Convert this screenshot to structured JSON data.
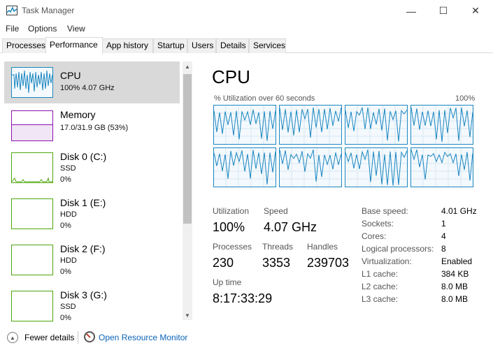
{
  "window": {
    "title": "Task Manager",
    "minimize_glyph": "—",
    "maximize_glyph": "☐",
    "close_glyph": "✕"
  },
  "menu": [
    "File",
    "Options",
    "View"
  ],
  "tabs": [
    "Processes",
    "Performance",
    "App history",
    "Startup",
    "Users",
    "Details",
    "Services"
  ],
  "active_tab": "Performance",
  "sidebar": {
    "items": [
      {
        "title": "CPU",
        "sub1": "100%  4.07 GHz",
        "sub2": "",
        "color": "#1a86c0",
        "selected": true
      },
      {
        "title": "Memory",
        "sub1": "17.0/31.9 GB (53%)",
        "sub2": "",
        "color": "#8b12ae",
        "selected": false
      },
      {
        "title": "Disk 0 (C:)",
        "sub1": "SSD",
        "sub2": "0%",
        "color": "#4da60c",
        "selected": false
      },
      {
        "title": "Disk 1 (E:)",
        "sub1": "HDD",
        "sub2": "0%",
        "color": "#4da60c",
        "selected": false
      },
      {
        "title": "Disk 2 (F:)",
        "sub1": "HDD",
        "sub2": "0%",
        "color": "#4da60c",
        "selected": false
      },
      {
        "title": "Disk 3 (G:)",
        "sub1": "SSD",
        "sub2": "0%",
        "color": "#4da60c",
        "selected": false
      }
    ]
  },
  "main": {
    "title": "CPU",
    "chart_label": "% Utilization over 60 seconds",
    "chart_max": "100%",
    "core_count_shown": 8,
    "stats": {
      "utilization_label": "Utilization",
      "utilization": "100%",
      "speed_label": "Speed",
      "speed": "4.07 GHz",
      "processes_label": "Processes",
      "processes": "230",
      "threads_label": "Threads",
      "threads": "3353",
      "handles_label": "Handles",
      "handles": "239703",
      "uptime_label": "Up time",
      "uptime": "8:17:33:29"
    },
    "specs": [
      {
        "label": "Base speed:",
        "value": "4.01 GHz"
      },
      {
        "label": "Sockets:",
        "value": "1"
      },
      {
        "label": "Cores:",
        "value": "4"
      },
      {
        "label": "Logical processors:",
        "value": "8"
      },
      {
        "label": "Virtualization:",
        "value": "Enabled"
      },
      {
        "label": "L1 cache:",
        "value": "384 KB"
      },
      {
        "label": "L2 cache:",
        "value": "8.0 MB"
      },
      {
        "label": "L3 cache:",
        "value": "8.0 MB"
      }
    ]
  },
  "footer": {
    "fewer_details": "Fewer details",
    "open_resource_monitor": "Open Resource Monitor"
  },
  "colors": {
    "cpu": "#1a86c0",
    "memory": "#8b12ae",
    "disk": "#4da60c",
    "link": "#0a63b8"
  },
  "icons": [
    "task-manager-icon",
    "minimize-icon",
    "maximize-icon",
    "close-icon",
    "chevron-up-icon",
    "chevron-down-icon",
    "collapse-icon",
    "resource-monitor-icon"
  ]
}
